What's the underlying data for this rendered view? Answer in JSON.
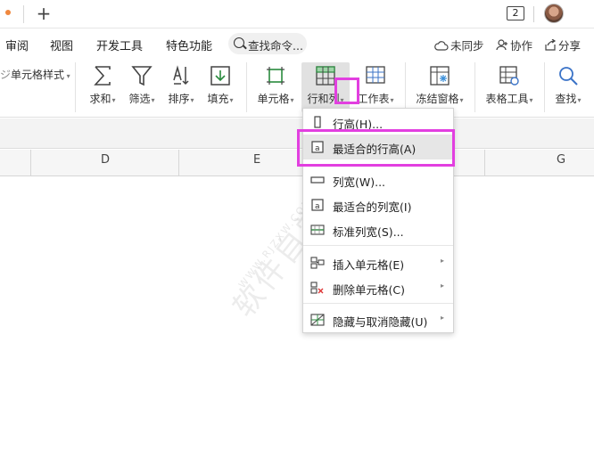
{
  "titlebar": {
    "window_count": "2"
  },
  "menubar": {
    "items": [
      "审阅",
      "视图",
      "开发工具",
      "特色功能"
    ],
    "search_label": "查找命令...",
    "right": [
      {
        "icon": "cloud-sync-icon",
        "label": "未同步"
      },
      {
        "icon": "collaborate-icon",
        "label": "协作"
      },
      {
        "icon": "share-icon",
        "label": "分享"
      }
    ]
  },
  "ribbon": {
    "cell_style_label": "单元格样式",
    "buttons": [
      {
        "icon": "sum-icon",
        "label": "求和"
      },
      {
        "icon": "filter-icon",
        "label": "筛选"
      },
      {
        "icon": "sort-icon",
        "label": "排序"
      },
      {
        "icon": "fill-icon",
        "label": "填充"
      },
      {
        "icon": "cell-icon",
        "label": "单元格"
      },
      {
        "icon": "row-col-icon",
        "label": "行和列"
      },
      {
        "icon": "worksheet-icon",
        "label": "工作表"
      },
      {
        "icon": "freeze-panes-icon",
        "label": "冻结窗格"
      },
      {
        "icon": "table-tools-icon",
        "label": "表格工具"
      },
      {
        "icon": "find-icon",
        "label": "查找"
      }
    ]
  },
  "columns": [
    "D",
    "E",
    "G"
  ],
  "dropdown": {
    "items": [
      {
        "icon": "row-height-icon",
        "label": "行高(H)..."
      },
      {
        "icon": "autofit-row-height-icon",
        "label": "最适合的行高(A)"
      },
      {
        "icon": "column-width-icon",
        "label": "列宽(W)..."
      },
      {
        "icon": "autofit-column-width-icon",
        "label": "最适合的列宽(I)"
      },
      {
        "icon": "standard-column-width-icon",
        "label": "标准列宽(S)..."
      },
      {
        "icon": "insert-cells-icon",
        "label": "插入单元格(E)"
      },
      {
        "icon": "delete-cells-icon",
        "label": "删除单元格(C)"
      },
      {
        "icon": "hide-unhide-icon",
        "label": "隐藏与取消隐藏(U)"
      }
    ]
  },
  "watermark": {
    "text": "软件自学网",
    "url": "WWW.RJZXW.COM"
  },
  "colors": {
    "highlight": "#e23fe0",
    "tab_dot": "#f0883e",
    "hover": "#e6e6e6"
  }
}
